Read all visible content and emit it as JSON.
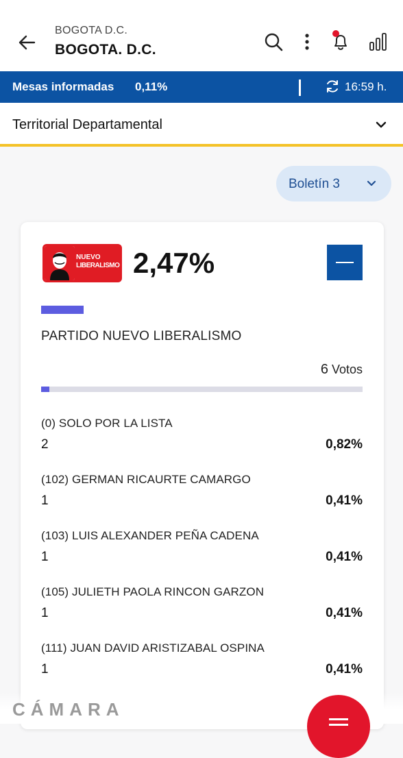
{
  "header": {
    "subtitle": "BOGOTA D.C.",
    "title": "BOGOTA. D.C."
  },
  "status": {
    "label": "Mesas informadas",
    "percent": "0,11%",
    "time": "16:59 h."
  },
  "filter": {
    "selected": "Territorial Departamental"
  },
  "bulletin": {
    "label": "Boletín 3"
  },
  "party": {
    "logo_line1": "NUEVO",
    "logo_line2": "LIBERALISMO",
    "percent": "2,47%",
    "name": "PARTIDO NUEVO LIBERALISMO",
    "votes_count": "6",
    "votes_label": "Votos",
    "progress_fraction": 0.0247,
    "accent_color": "#5c5ce0"
  },
  "candidates": [
    {
      "name": "(0) SOLO POR LA LISTA",
      "votes": "2",
      "percent": "0,82%"
    },
    {
      "name": "(102) GERMAN RICAURTE CAMARGO",
      "votes": "1",
      "percent": "0,41%"
    },
    {
      "name": "(103) LUIS ALEXANDER PEÑA CADENA",
      "votes": "1",
      "percent": "0,41%"
    },
    {
      "name": "(105) JULIETH PAOLA RINCON GARZON",
      "votes": "1",
      "percent": "0,41%"
    },
    {
      "name": "(111) JUAN DAVID ARISTIZABAL OSPINA",
      "votes": "1",
      "percent": "0,41%"
    }
  ],
  "footer": {
    "brand": "CÁMARA"
  },
  "colors": {
    "primary_blue": "#0c53a3",
    "accent_yellow": "#f4c228",
    "brand_red": "#e2152b"
  }
}
